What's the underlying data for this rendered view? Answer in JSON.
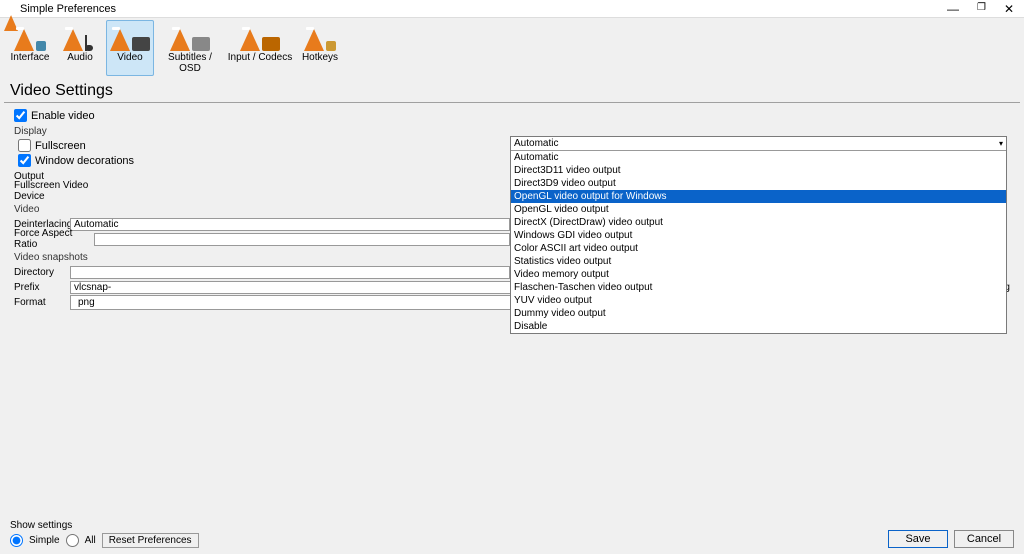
{
  "window": {
    "title": "Simple Preferences"
  },
  "toolbar": {
    "interface": "Interface",
    "audio": "Audio",
    "video": "Video",
    "subtitles": "Subtitles / OSD",
    "input": "Input / Codecs",
    "hotkeys": "Hotkeys"
  },
  "section_title": "Video Settings",
  "enable_video": {
    "label": "Enable video",
    "checked": true
  },
  "display": {
    "header": "Display",
    "fullscreen": {
      "label": "Fullscreen",
      "checked": false
    },
    "window_decorations": {
      "label": "Window decorations",
      "checked": true
    },
    "output_label": "Output",
    "fullscreen_device_label": "Fullscreen Video Device"
  },
  "output_dropdown": {
    "selected": "Automatic",
    "items": [
      "Automatic",
      "Direct3D11 video output",
      "Direct3D9 video output",
      "OpenGL video output for Windows",
      "OpenGL video output",
      "DirectX (DirectDraw) video output",
      "Windows GDI video output",
      "Color ASCII art video output",
      "Statistics video output",
      "Video memory output",
      "Flaschen-Taschen video output",
      "YUV video output",
      "Dummy video output",
      "Disable"
    ],
    "highlighted_index": 3
  },
  "video_group": {
    "header": "Video",
    "deinterlacing_label": "Deinterlacing",
    "deinterlacing_value": "Automatic",
    "force_ar_label": "Force Aspect Ratio",
    "force_ar_value": ""
  },
  "snapshots": {
    "header": "Video snapshots",
    "directory_label": "Directory",
    "directory_value": "",
    "prefix_label": "Prefix",
    "prefix_value": "vlcsnap-",
    "sequential_label": "Sequential numbering",
    "sequential_checked": false,
    "format_label": "Format",
    "format_value": "png"
  },
  "footer": {
    "show_settings": "Show settings",
    "simple": "Simple",
    "all": "All",
    "reset": "Reset Preferences",
    "save": "Save",
    "cancel": "Cancel"
  }
}
